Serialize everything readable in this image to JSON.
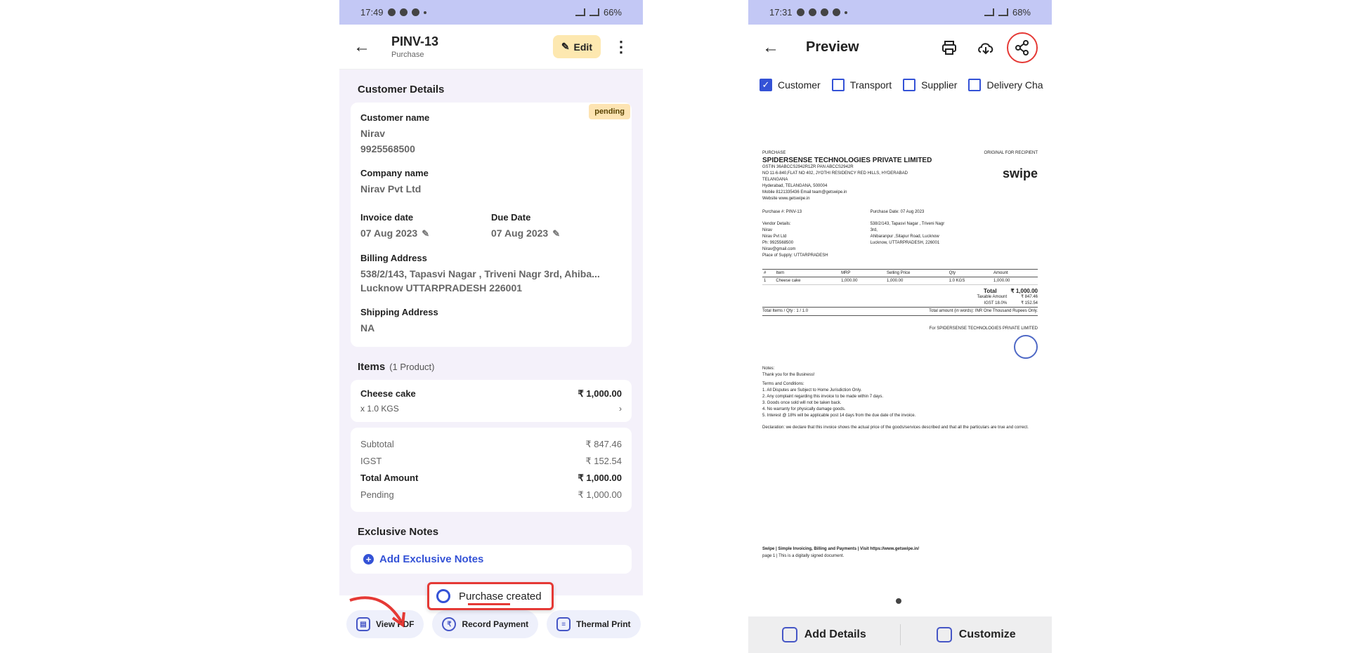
{
  "left": {
    "status": {
      "time": "17:49",
      "battery": "66%"
    },
    "header": {
      "title": "PINV-13",
      "subtitle": "Purchase",
      "edit_label": "Edit"
    },
    "customer_details": {
      "section_title": "Customer Details",
      "badge": "pending",
      "customer_name_label": "Customer name",
      "customer_name": "Nirav",
      "customer_phone": "9925568500",
      "company_name_label": "Company name",
      "company_name": "Nirav Pvt Ltd",
      "invoice_date_label": "Invoice date",
      "invoice_date": "07 Aug 2023",
      "due_date_label": "Due Date",
      "due_date": "07 Aug 2023",
      "billing_address_label": "Billing Address",
      "billing_address_line1": "538/2/143, Tapasvi Nagar , Triveni Nagr 3rd, Ahiba...",
      "billing_address_line2": "Lucknow UTTARPRADESH 226001",
      "shipping_address_label": "Shipping Address",
      "shipping_address": "NA"
    },
    "items": {
      "section_title": "Items",
      "count": "(1 Product)",
      "item_name": "Cheese cake",
      "item_price": "₹ 1,000.00",
      "item_qty": "x 1.0 KGS",
      "chevron": "›"
    },
    "summary": {
      "subtotal_label": "Subtotal",
      "subtotal": "₹ 847.46",
      "igst_label": "IGST",
      "igst": "₹ 152.54",
      "total_label": "Total Amount",
      "total": "₹ 1,000.00",
      "pending_label": "Pending",
      "pending": "₹ 1,000.00"
    },
    "notes": {
      "section_title": "Exclusive Notes",
      "add_label": "Add Exclusive Notes"
    },
    "toast": "Purchase created",
    "bottom_actions": {
      "view_pdf": "View PDF",
      "record_payment": "Record Payment",
      "thermal_print": "Thermal Print"
    }
  },
  "right": {
    "status": {
      "time": "17:31",
      "battery": "68%"
    },
    "header": {
      "title": "Preview"
    },
    "checkboxes": [
      {
        "label": "Customer",
        "checked": true
      },
      {
        "label": "Transport",
        "checked": false
      },
      {
        "label": "Supplier",
        "checked": false
      },
      {
        "label": "Delivery Cha",
        "checked": false
      }
    ],
    "doc": {
      "type_label": "PURCHASE",
      "original_label": "ORIGINAL FOR RECIPIENT",
      "company": "SPIDERSENSE TECHNOLOGIES PRIVATE LIMITED",
      "gstin": "GSTIN 36ABCCS2942R1ZR  PAN ABCCS2942R",
      "address1": "NO 11-6-840,FLAT NO 402, JYOTHI RESIDENCY RED HILLS, HYDERABAD",
      "address2": "TELANGANA",
      "address3": "Hyderabad, TELANGANA, 500004",
      "contact": "Mobile 8121335436     Email team@getswipe.in",
      "website": "Website www.getswipe.in",
      "logo": "swipe",
      "purchase_no": "Purchase #: PINV-13",
      "purchase_date": "Purchase Date: 07 Aug 2023",
      "vendor_label": "Vendor Details:",
      "vendor_name": "Nirav",
      "vendor_company": "Nirav Pvt Ltd",
      "vendor_phone": "Ph: 9925568500",
      "vendor_email": "Nirav@gmail.com",
      "place_of_supply": "Place of Supply: UTTARPRADESH",
      "vendor_addr1": "538/2/143, Tapasvi Nagar , Triveni Nagr",
      "vendor_addr2": "3rd,",
      "vendor_addr3": "Ahibaranpur ,Sitapur Road, Lucknow",
      "vendor_addr4": "Lucknow, UTTARPRADESH, 226001",
      "table_headers": [
        "#",
        "Item",
        "MRP",
        "Selling Price",
        "Qty",
        "Amount"
      ],
      "table_row": [
        "1",
        "Cheese cake",
        "1,000.00",
        "1,000.00",
        "1.0 KGS",
        "1,000.00"
      ],
      "total_label": "Total",
      "total": "₹ 1,000.00",
      "taxable_label": "Taxable Amount",
      "taxable": "₹ 847.46",
      "igst_label": "IGST 18.0%",
      "igst": "₹ 152.54",
      "total_items": "Total Items / Qty : 1 / 1.0",
      "in_words": "Total amount (in words): INR One Thousand Rupees Only.",
      "for_company": "For SPIDERSENSE TECHNOLOGIES PRIVATE LIMITED",
      "notes_label": "Notes:",
      "notes_text": "Thank you for the Business!",
      "terms_label": "Terms and Conditions:",
      "terms": [
        "1. All Disputes are Subject to Home Jurisdiction Only.",
        "2. Any complaint regarding this invoice to be made within 7 days.",
        "3. Goods once sold will not be taken back.",
        "4. No warranty for physically damage goods.",
        "5. Interest @ 18% will be applicable post 14 days from the due date of the invoice."
      ],
      "declaration": "Declaration: we declare that this invoice shows the actual price of the goods/services described and that all the particulars are true and correct.",
      "footer": "Swipe | Simple Invoicing, Billing and Payments | Visit https://www.getswipe.in/",
      "footer_sub": "page 1 | This is a digitally signed document."
    },
    "bottom_actions": {
      "add_details": "Add Details",
      "customize": "Customize"
    }
  }
}
